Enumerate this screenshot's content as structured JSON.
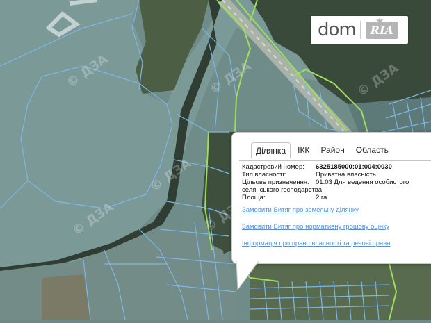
{
  "logo": {
    "dom": "dom",
    "ria": "RIA"
  },
  "watermark": "© ДЗА",
  "popup": {
    "tabs": [
      "Ділянка",
      "ІКК",
      "Район",
      "Область"
    ],
    "active_tab": "Ділянка",
    "fields": {
      "cadastral_label": "Кадастровий номер:",
      "cadastral_value": "6325185000:01:004:0030",
      "ownership_label": "Тип власності:",
      "ownership_value": "Приватна власність",
      "purpose_label": "Цільове призначення:",
      "purpose_value": "01.03 Для ведення особистого селянського господарства",
      "area_label": "Площа:",
      "area_value": "2 га"
    },
    "links": [
      "Замовити Витяг про земельну ділянку",
      "Замовити Витяг про нормативну грошову оцінку",
      "Інформація про право власності та речові права"
    ]
  },
  "colors": {
    "parcel_line": "#7fb6e6",
    "green_line": "#9fe05a",
    "link": "#5a8fd0"
  }
}
